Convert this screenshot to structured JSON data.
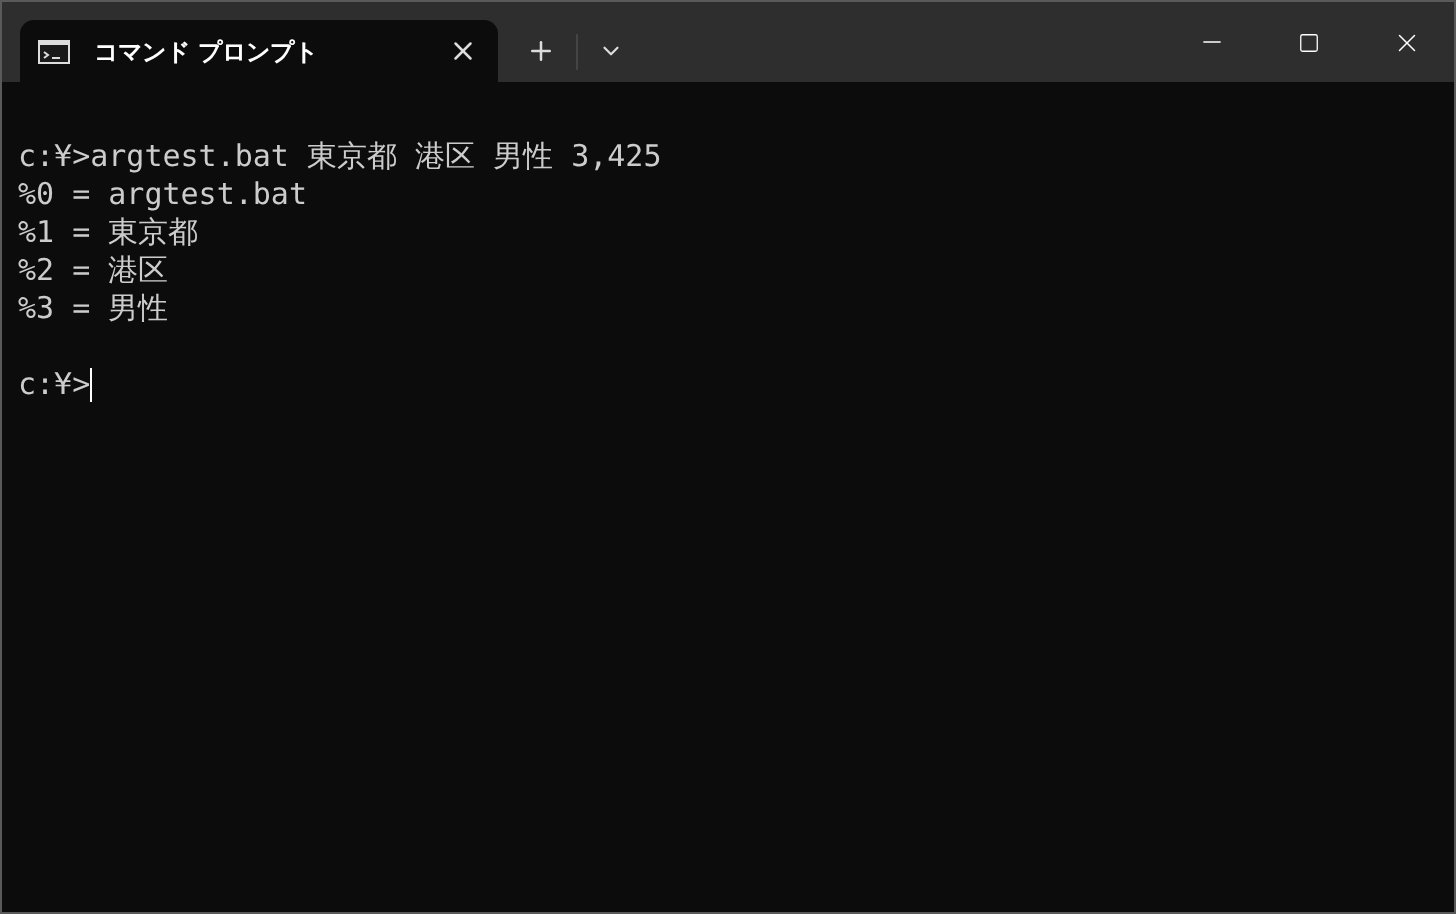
{
  "tab": {
    "title": "コマンド プロンプト",
    "selected": true
  },
  "terminal": {
    "lines": [
      {
        "kind": "text",
        "text": "c:¥>argtest.bat 東京都 港区 男性 3,425"
      },
      {
        "kind": "text",
        "text": "%0 = argtest.bat"
      },
      {
        "kind": "text",
        "text": "%1 = 東京都"
      },
      {
        "kind": "text",
        "text": "%2 = 港区"
      },
      {
        "kind": "text",
        "text": "%3 = 男性"
      },
      {
        "kind": "blank"
      }
    ],
    "prompt": {
      "text": "c:¥>",
      "cursor": true
    }
  }
}
